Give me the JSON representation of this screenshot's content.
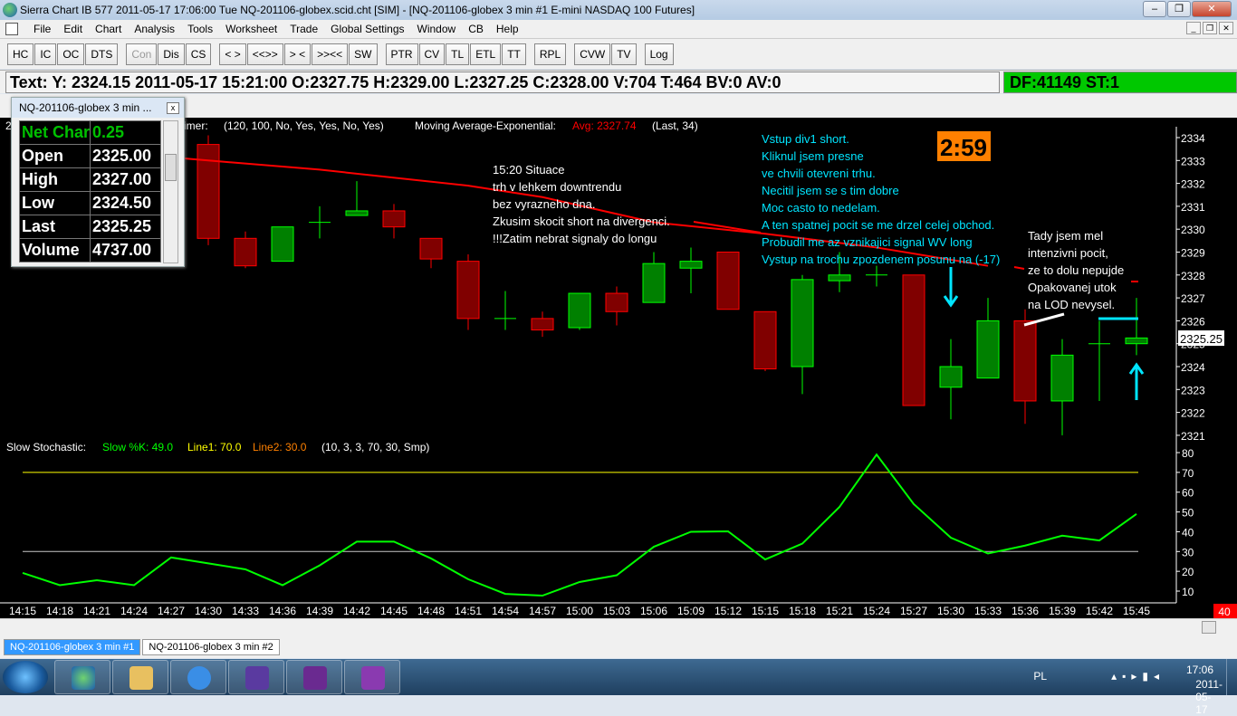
{
  "window": {
    "title": "Sierra Chart IB 577  2011-05-17  17:06:00  Tue   NQ-201106-globex.scid.cht [SIM] - [NQ-201106-globex  3 min   #1  E-mini NASDAQ 100 Futures]",
    "min": "–",
    "max": "❐",
    "close": "✕"
  },
  "menu": [
    "File",
    "Edit",
    "Chart",
    "Analysis",
    "Tools",
    "Worksheet",
    "Trade",
    "Global Settings",
    "Window",
    "CB",
    "Help"
  ],
  "mdi": {
    "min": "_",
    "restore": "❐",
    "close": "✕"
  },
  "toolbar": [
    {
      "label": "HC"
    },
    {
      "label": "IC"
    },
    {
      "label": "OC"
    },
    {
      "label": "DTS"
    },
    {
      "gap": true
    },
    {
      "label": "Con",
      "disabled": true
    },
    {
      "label": "Dis"
    },
    {
      "label": "CS"
    },
    {
      "gap": true
    },
    {
      "label": "< >"
    },
    {
      "label": "<<>>"
    },
    {
      "label": "> <"
    },
    {
      "label": ">><<"
    },
    {
      "label": "SW"
    },
    {
      "gap": true
    },
    {
      "label": "PTR"
    },
    {
      "label": "CV"
    },
    {
      "label": "TL"
    },
    {
      "label": "ETL"
    },
    {
      "label": "TT"
    },
    {
      "gap": true
    },
    {
      "label": "RPL"
    },
    {
      "gap": true
    },
    {
      "label": "CVW"
    },
    {
      "label": "TV"
    },
    {
      "gap": true
    },
    {
      "label": "Log"
    }
  ],
  "textbar": {
    "main": "Text: Y: 2324.15  2011-05-17  15:21:00  O:2327.75  H:2329.00  L:2327.25  C:2328.00  V:704  T:464  BV:0  AV:0",
    "df": "DF:41149  ST:1"
  },
  "data_window": {
    "title": "NQ-201106-globex  3 min   ...",
    "close": "x",
    "rows": [
      {
        "label": "Net Char",
        "value": "0.25",
        "color": "#00c000"
      },
      {
        "label": "Open",
        "value": "2325.00"
      },
      {
        "label": "High",
        "value": "2327.00"
      },
      {
        "label": "Low",
        "value": "2324.50"
      },
      {
        "label": "Last",
        "value": "2325.25"
      },
      {
        "label": "Volume",
        "value": "4737.00"
      }
    ]
  },
  "study_header": {
    "prefix": "2",
    "timer": "imer:",
    "timer_params": "(120, 100, No, Yes, Yes, No, Yes)",
    "ma_label": "Moving Average-Exponential:",
    "ma_value": "Avg: 2327.74",
    "ma_params": "(Last, 34)"
  },
  "stoch_header": {
    "label": "Slow Stochastic:",
    "k": "Slow %K: 49.0",
    "line1": "Line1: 70.0",
    "line2": "Line2: 30.0",
    "params": "(10, 3, 3, 70, 30, Smp)"
  },
  "timer_box": "2:59",
  "last_price_label": "2325.25",
  "bars_remaining": "40",
  "colors": {
    "up": "#008000",
    "up_border": "#00ff00",
    "down": "#800000",
    "down_border": "#ff0000",
    "ma": "#ff0000",
    "stoch": "#00ff00",
    "line1": "#ffff00",
    "line2": "#c8c8c8",
    "annot_cyan": "#00e5ff",
    "timer_bg": "#ff8000"
  },
  "annotations": {
    "white": [
      "15:20 Situace",
      "trh v lehkem downtrendu",
      "bez vyrazneho dna.",
      "Zkusim skocit short na divergenci.",
      "!!!Zatim nebrat signaly do longu"
    ],
    "cyan": [
      "Vstup div1 short.",
      "Kliknul jsem presne",
      "ve chvili otevreni trhu.",
      "Necitil jsem se s tim dobre",
      "Moc casto to nedelam.",
      "A ten spatnej pocit se me drzel celej obchod.",
      "Probudil me az vznikajici signal WV long",
      "Vystup na trochu zpozdenem posunu na (-17)"
    ],
    "right": [
      "Tady jsem mel",
      "intenzivni pocit,",
      "ze to dolu nepujde",
      "Opakovanej utok",
      "na LOD nevysel."
    ]
  },
  "tabs": [
    {
      "label": "NQ-201106-globex  3 min   #1",
      "active": true
    },
    {
      "label": "NQ-201106-globex  3 min   #2"
    }
  ],
  "tray": {
    "lang": "PL",
    "time": "17:06",
    "date": "2011-05-17"
  },
  "chart_data": {
    "type": "candlestick",
    "times": [
      "14:15",
      "14:18",
      "14:21",
      "14:24",
      "14:27",
      "14:30",
      "14:33",
      "14:36",
      "14:39",
      "14:42",
      "14:45",
      "14:48",
      "14:51",
      "14:54",
      "14:57",
      "15:00",
      "15:03",
      "15:06",
      "15:09",
      "15:12",
      "15:15",
      "15:18",
      "15:21",
      "15:24",
      "15:27",
      "15:30",
      "15:33",
      "15:36",
      "15:39",
      "15:42",
      "15:45"
    ],
    "ohlc": [
      null,
      null,
      null,
      null,
      null,
      [
        2333.7,
        2334.1,
        2329.3,
        2329.6
      ],
      [
        2329.6,
        2329.9,
        2328.3,
        2328.4
      ],
      [
        2328.6,
        2330.1,
        2328.6,
        2330.1
      ],
      [
        2330.3,
        2331.0,
        2329.6,
        2330.3
      ],
      [
        2330.6,
        2332.1,
        2330.6,
        2330.8
      ],
      [
        2330.8,
        2331.1,
        2329.6,
        2330.1
      ],
      [
        2329.6,
        2329.6,
        2328.3,
        2328.7
      ],
      [
        2328.6,
        2328.9,
        2325.6,
        2326.1
      ],
      [
        2326.1,
        2327.3,
        2325.6,
        2326.1
      ],
      [
        2326.1,
        2326.4,
        2325.3,
        2325.6
      ],
      [
        2325.7,
        2327.2,
        2325.6,
        2327.2
      ],
      [
        2327.2,
        2327.5,
        2325.8,
        2326.4
      ],
      [
        2326.8,
        2329.0,
        2326.8,
        2328.5
      ],
      [
        2328.3,
        2329.2,
        2327.2,
        2328.6
      ],
      [
        2329.0,
        2329.0,
        2326.5,
        2326.5
      ],
      [
        2326.4,
        2326.4,
        2323.8,
        2323.9
      ],
      [
        2324.0,
        2328.0,
        2322.8,
        2327.8
      ],
      [
        2327.75,
        2329.0,
        2327.25,
        2328.0
      ],
      [
        2328.0,
        2328.4,
        2327.5,
        2328.0
      ],
      [
        2328.0,
        2328.0,
        2322.3,
        2322.3
      ],
      [
        2323.1,
        2325.2,
        2321.7,
        2324.0
      ],
      [
        2323.5,
        2327.0,
        2323.5,
        2326.0
      ],
      [
        2326.0,
        2326.5,
        2321.5,
        2322.5
      ],
      [
        2322.5,
        2325.2,
        2321.0,
        2324.5
      ],
      [
        2325.0,
        2326.0,
        2322.5,
        2325.0
      ],
      [
        2325.0,
        2327.0,
        2324.5,
        2325.25
      ]
    ],
    "ma": [
      [
        5,
        2333.0
      ],
      [
        8,
        2332.6
      ],
      [
        12,
        2331.9
      ],
      [
        14,
        2331.4
      ],
      [
        17,
        2330.3
      ],
      [
        20,
        2329.8
      ],
      [
        23,
        2329.2
      ],
      [
        26,
        2328.4
      ]
    ],
    "price_ticks": [
      2334,
      2333,
      2332,
      2331,
      2330,
      2329,
      2328,
      2327,
      2326,
      2325,
      2324,
      2323,
      2322,
      2321
    ],
    "stoch_k": [
      19.2,
      13,
      15.5,
      13,
      27,
      24,
      21,
      13,
      23,
      35,
      35,
      26.5,
      16,
      8.6,
      7.7,
      14.6,
      18,
      32.4,
      40,
      40.2,
      26,
      34,
      52.5,
      79,
      54,
      37,
      29,
      33,
      38,
      35.6,
      49
    ],
    "stoch_ticks": [
      80,
      70,
      60,
      50,
      40,
      30,
      20,
      10
    ],
    "line1": 70,
    "line2": 30
  }
}
